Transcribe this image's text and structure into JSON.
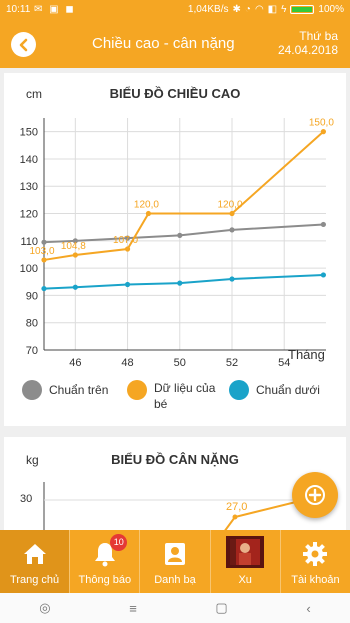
{
  "status_bar": {
    "time": "10:11",
    "network_speed": "1,04KB/s",
    "battery": "100%"
  },
  "header": {
    "title": "Chiều cao - cân nặng",
    "weekday": "Thứ ba",
    "date": "24.04.2018"
  },
  "height_chart": {
    "title": "BIỂU ĐỒ CHIỀU CAO",
    "unit": "cm",
    "xlabel": "Tháng"
  },
  "weight_chart": {
    "title": "BIỂU ĐỒ CÂN NẶNG",
    "unit": "kg",
    "tick": "30",
    "value_label": "27,0"
  },
  "legend": [
    {
      "label": "Chuẩn trên",
      "color": "#8c8c8c"
    },
    {
      "label": "Dữ liệu của bé",
      "color": "#f5a623"
    },
    {
      "label": "Chuẩn dưới",
      "color": "#1aa3c9"
    }
  ],
  "nav": [
    {
      "label": "Trang chủ",
      "icon": "home-icon"
    },
    {
      "label": "Thông báo",
      "icon": "bell-icon",
      "badge": "10"
    },
    {
      "label": "Danh bạ",
      "icon": "contacts-icon"
    },
    {
      "label": "Xu",
      "icon": "avatar-image"
    },
    {
      "label": "Tài khoản",
      "icon": "gear-icon"
    }
  ],
  "chart_data": [
    {
      "type": "line",
      "title": "BIỂU ĐỒ CHIỀU CAO",
      "ylabel": "cm",
      "xlabel": "Tháng",
      "xlim": [
        44.8,
        55.6
      ],
      "ylim": [
        70,
        155
      ],
      "xticks": [
        46,
        48,
        50,
        52,
        54
      ],
      "yticks": [
        70,
        80,
        90,
        100,
        110,
        120,
        130,
        140,
        150
      ],
      "series": [
        {
          "name": "Chuẩn trên",
          "color": "#8c8c8c",
          "x": [
            44.8,
            46,
            48,
            50,
            52,
            55.5
          ],
          "y": [
            109.5,
            110,
            111,
            112,
            114,
            116
          ],
          "labels": []
        },
        {
          "name": "Dữ liệu của bé",
          "color": "#f5a623",
          "x": [
            44.8,
            46,
            48,
            48.8,
            52,
            55.5
          ],
          "y": [
            103,
            104.8,
            107,
            120,
            120,
            150
          ],
          "labels": [
            "103,0",
            "104,8",
            "107,0",
            "120,0",
            "120,0",
            "150,0"
          ]
        },
        {
          "name": "Chuẩn dưới",
          "color": "#1aa3c9",
          "x": [
            44.8,
            46,
            48,
            50,
            52,
            55.5
          ],
          "y": [
            92.5,
            93,
            94,
            94.5,
            96,
            97.5
          ],
          "labels": []
        }
      ]
    }
  ]
}
